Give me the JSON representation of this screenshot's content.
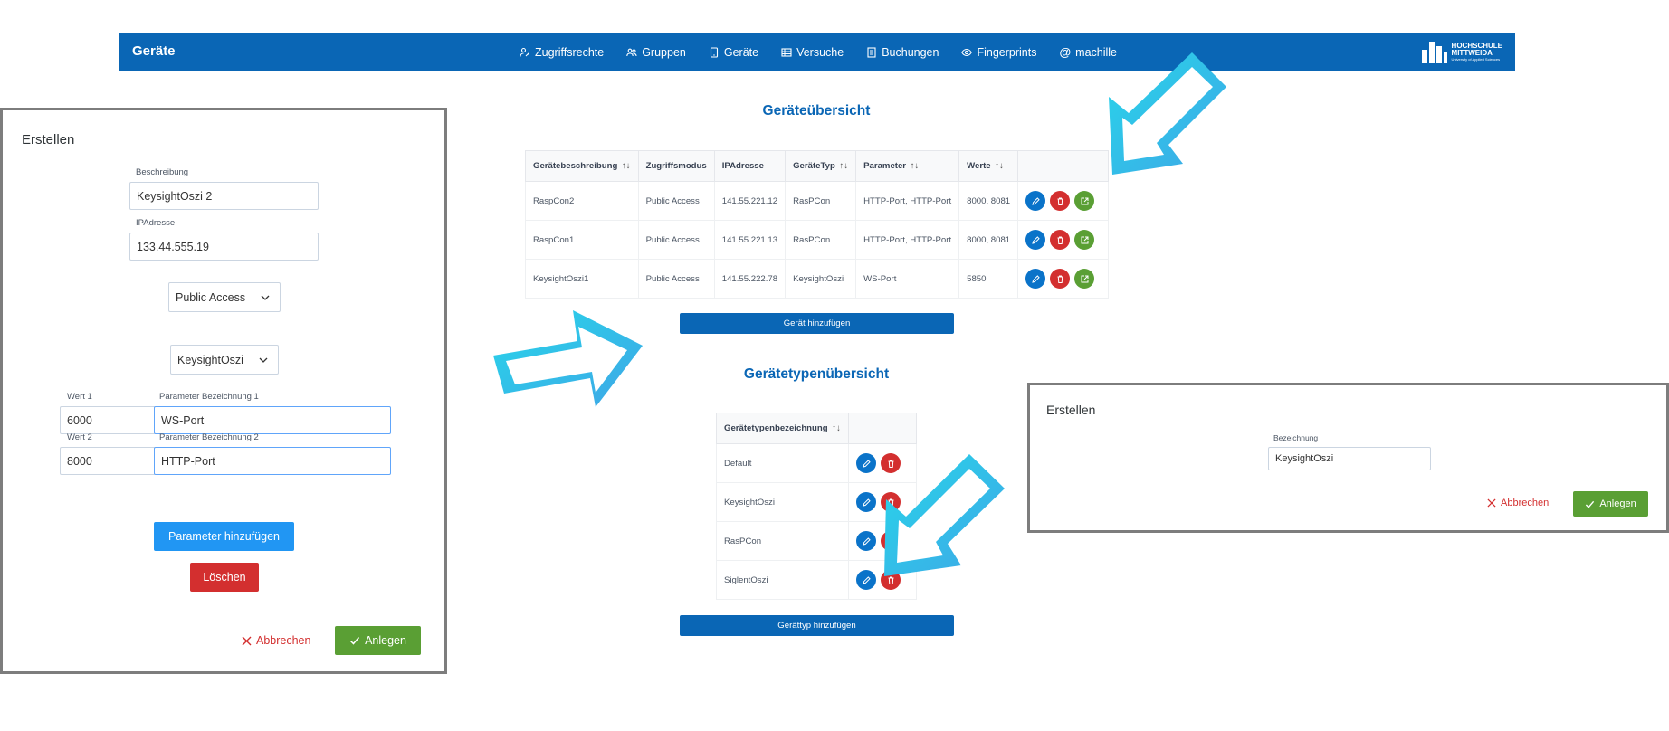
{
  "navbar": {
    "brand": "Geräte",
    "items": [
      {
        "label": "Zugriffsrechte",
        "icon": "user-key-icon"
      },
      {
        "label": "Gruppen",
        "icon": "users-icon"
      },
      {
        "label": "Geräte",
        "icon": "device-icon"
      },
      {
        "label": "Versuche",
        "icon": "list-icon"
      },
      {
        "label": "Buchungen",
        "icon": "book-icon"
      },
      {
        "label": "Fingerprints",
        "icon": "eye-icon"
      },
      {
        "label": "machille",
        "icon": "at-icon"
      }
    ],
    "logo": {
      "line1": "HOCHSCHULE",
      "line2": "MITTWEIDA",
      "line3": "University of Applied Sciences"
    }
  },
  "devices": {
    "title": "Geräteübersicht",
    "columns": [
      "Gerätebeschreibung",
      "Zugriffsmodus",
      "IPAdresse",
      "GeräteTyp",
      "Parameter",
      "Werte"
    ],
    "rows": [
      [
        "RaspCon2",
        "Public Access",
        "141.55.221.12",
        "RasPCon",
        "HTTP-Port, HTTP-Port",
        "8000, 8081"
      ],
      [
        "RaspCon1",
        "Public Access",
        "141.55.221.13",
        "RasPCon",
        "HTTP-Port, HTTP-Port",
        "8000, 8081"
      ],
      [
        "KeysightOszi1",
        "Public Access",
        "141.55.222.78",
        "KeysightOszi",
        "WS-Port",
        "5850"
      ]
    ],
    "add_button": "Gerät hinzufügen"
  },
  "device_types": {
    "title": "Gerätetypenübersicht",
    "column": "Gerätetypenbezeichnung",
    "rows": [
      "Default",
      "KeysightOszi",
      "RasPCon",
      "SiglentOszi"
    ],
    "add_button": "Gerättyp hinzufügen"
  },
  "create_device_dialog": {
    "title": "Erstellen",
    "beschreibung_label": "Beschreibung",
    "beschreibung_value": "KeysightOszi 2",
    "ip_label": "IPAdresse",
    "ip_value": "133.44.555.19",
    "access_select": "Public Access",
    "type_select": "KeysightOszi",
    "params": [
      {
        "wert_label": "Wert 1",
        "wert": "6000",
        "name_label": "Parameter Bezeichnung 1",
        "name": "WS-Port"
      },
      {
        "wert_label": "Wert 2",
        "wert": "8000",
        "name_label": "Parameter Bezeichnung 2",
        "name": "HTTP-Port"
      }
    ],
    "add_param_button": "Parameter hinzufügen",
    "delete_button": "Löschen",
    "cancel_button": "Abbrechen",
    "create_button": "Anlegen"
  },
  "create_type_dialog": {
    "title": "Erstellen",
    "label": "Bezeichnung",
    "value": "KeysightOszi",
    "cancel_button": "Abbrechen",
    "create_button": "Anlegen"
  },
  "colors": {
    "primary": "#0a66b5",
    "danger": "#d32f2f",
    "success": "#5a9f34",
    "arrow": "#22c9e8"
  }
}
